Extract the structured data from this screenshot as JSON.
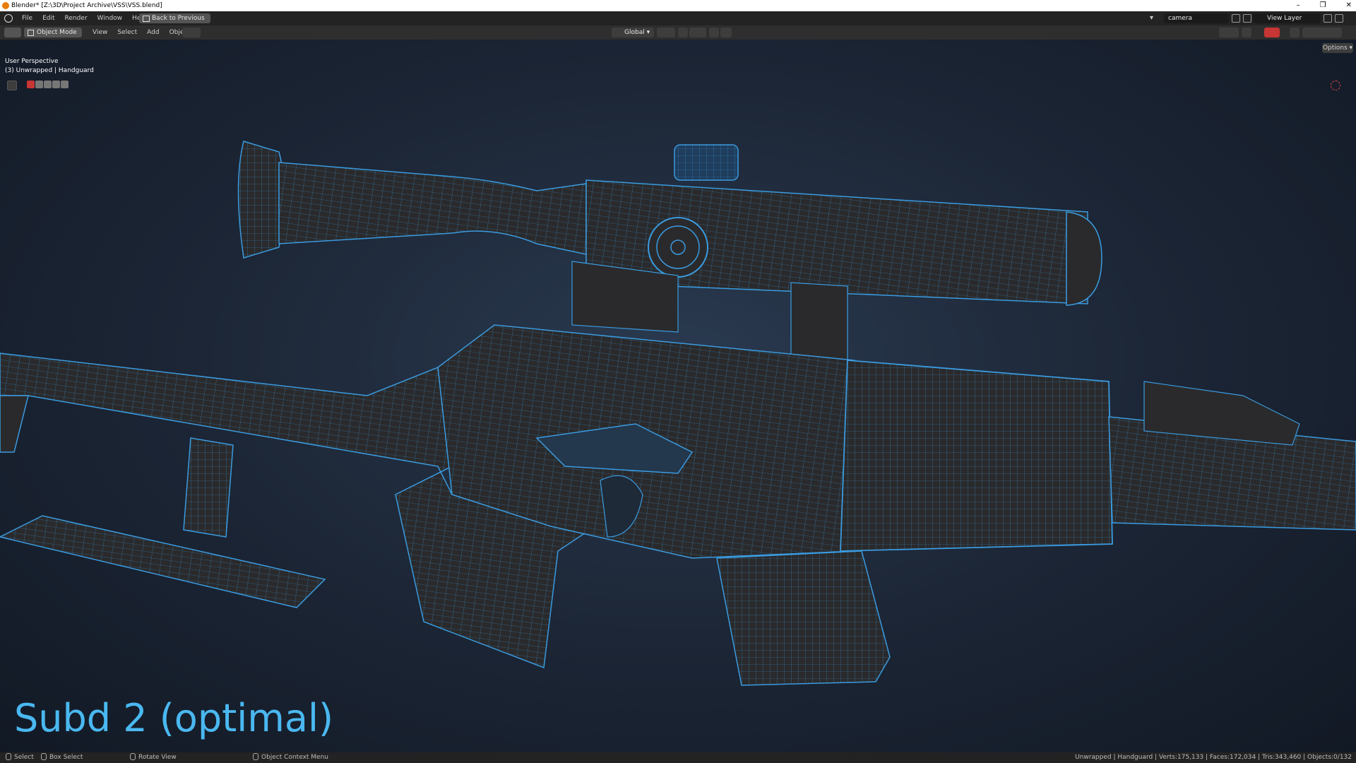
{
  "window": {
    "title": "Blender* [Z:\\3D\\Project Archive\\VSS\\VSS.blend]",
    "controls": [
      "–",
      "❐",
      "✕"
    ]
  },
  "topbar": {
    "menus": [
      "File",
      "Edit",
      "Render",
      "Window",
      "Help"
    ],
    "back_button": "Back to Previous",
    "scene_name": "camera",
    "view_layer": "View Layer"
  },
  "viewport_header": {
    "mode": "Object Mode",
    "menus": [
      "View",
      "Select",
      "Add",
      "Object"
    ],
    "transform_orientation": "Global",
    "options_label": "Options"
  },
  "viewport": {
    "view_name": "User Perspective",
    "object_info": "(3) Unwrapped | Handguard",
    "caption": "Subd 2 (optimal)",
    "wire_color": "#3a9be0",
    "mesh_color": "#2a2a2c",
    "background_color": "#1c2636"
  },
  "statusbar": {
    "select": "Select",
    "box_select": "Box Select",
    "rotate": "Rotate View",
    "context_menu": "Object Context Menu",
    "stats": "Unwrapped | Handguard | Verts:175,133 | Faces:172,034 | Tris:343,460 | Objects:0/132"
  }
}
